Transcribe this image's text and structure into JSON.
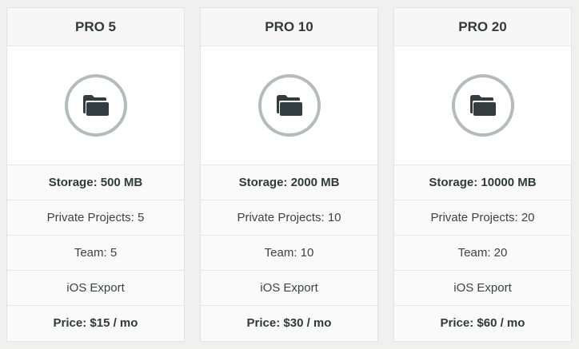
{
  "plans": [
    {
      "name": "PRO 5",
      "icon": "folder-icon",
      "storage": "Storage: 500 MB",
      "projects": "Private Projects: 5",
      "team": "Team: 5",
      "export": "iOS Export",
      "price": "Price: $15 / mo"
    },
    {
      "name": "PRO 10",
      "icon": "folder-icon",
      "storage": "Storage: 2000 MB",
      "projects": "Private Projects: 10",
      "team": "Team: 10",
      "export": "iOS Export",
      "price": "Price: $30 / mo"
    },
    {
      "name": "PRO 20",
      "icon": "folder-icon",
      "storage": "Storage: 10000 MB",
      "projects": "Private Projects: 20",
      "team": "Team: 20",
      "export": "iOS Export",
      "price": "Price: $60 / mo"
    }
  ],
  "colors": {
    "background": "#f0f0ef",
    "card": "#ffffff",
    "ring": "#b3bcba",
    "folder": "#333d3f",
    "text": "#333b3d"
  }
}
